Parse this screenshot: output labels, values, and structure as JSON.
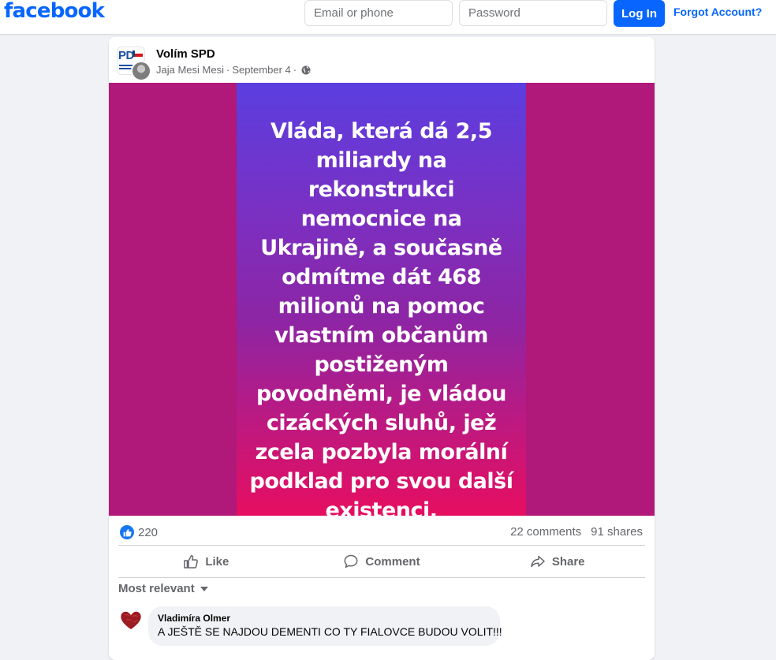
{
  "header": {
    "logo": "facebook",
    "email_placeholder": "Email or phone",
    "password_placeholder": "Password",
    "login_label": "Log In",
    "forgot_label": "Forgot Account?"
  },
  "post": {
    "group_name": "Volím SPD",
    "page_avatar_text": "PD",
    "author": "Jaja Mesi Mesi",
    "date": "September 4",
    "separator": "·",
    "image_text": "Vláda, která dá 2,5\nmiliardy na\nrekonstrukci\nnemocnice na\nUkrajině, a současně\nodmítme dát 468\nmilionů na pomoc\nvlastním občanům\npostiženým\npovodněmi, je vládou\ncizáckých sluhů, jež\nzcela pozbyla morální\npodklad pro svou další\nexistenci.",
    "reaction_count": "220",
    "comments": "22 comments",
    "shares": "91 shares"
  },
  "actions": {
    "like": "Like",
    "comment": "Comment",
    "share": "Share"
  },
  "sort_label": "Most relevant",
  "comment": {
    "author": "Vladimíra Olmer",
    "text": "A JEŠTĚ SE NAJDOU DEMENTI CO TY FIALOVCE BUDOU VOLIT!!!"
  },
  "colors": {
    "brand": "#0866ff",
    "image_background": "#b0187a"
  }
}
